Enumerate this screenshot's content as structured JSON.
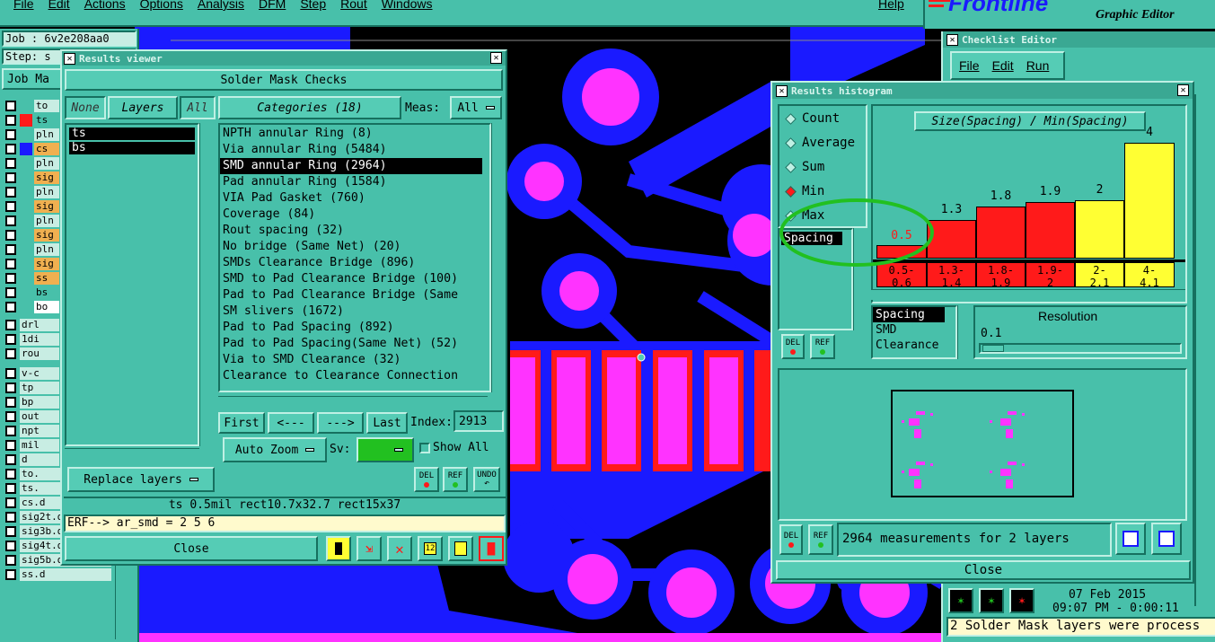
{
  "app": {
    "menu": [
      "File",
      "Edit",
      "Actions",
      "Options",
      "Analysis",
      "DFM",
      "Step",
      "Rout",
      "Windows"
    ],
    "help": "Help",
    "brand": "Frontline",
    "brand_sub": "Graphic Editor"
  },
  "job_label": "Job : 6v2e208aa0",
  "step_label": "Step: s",
  "job_matrix_btn": "Job Ma",
  "layers_panel": [
    "to",
    "ts",
    "pln",
    "cs",
    "pln",
    "sig",
    "pln",
    "sig",
    "pln",
    "sig",
    "pln",
    "sig",
    "ss",
    "bs",
    "bo",
    "drl",
    "1di",
    "rou",
    "v-c",
    "tp",
    "bp",
    "out",
    "npt",
    "mil",
    "d",
    "to.",
    "ts.",
    "cs.d",
    "sig2t.d",
    "sig3b.d",
    "sig4t.d",
    "sig5b.d",
    "ss.d"
  ],
  "results_viewer": {
    "title": "Results viewer",
    "header": "Solder Mask Checks",
    "none_btn": "None",
    "layers_btn": "Layers",
    "all_btn": "All",
    "layers": [
      "ts",
      "bs"
    ],
    "categories_btn": "Categories (18)",
    "meas_label": "Meas:",
    "meas_value": "All",
    "categories": [
      "NPTH annular Ring (8)",
      "Via annular Ring (5484)",
      "SMD annular Ring (2964)",
      "Pad annular Ring (1584)",
      "VIA Pad Gasket (760)",
      "Coverage (84)",
      "Rout spacing (32)",
      "No bridge (Same Net) (20)",
      "SMDs Clearance Bridge (896)",
      "SMD to Pad Clearance Bridge (100)",
      "Pad to Pad Clearance Bridge (Same",
      "SM slivers (1672)",
      "Pad to Pad Spacing (892)",
      "Pad to Pad Spacing(Same Net) (52)",
      "Via to SMD Clearance (32)",
      "Clearance to Clearance Connection"
    ],
    "first_btn": "First",
    "prev_btn": "<---",
    "next_btn": "--->",
    "last_btn": "Last",
    "index_label": "Index:",
    "index_value": "2913",
    "autozoom": "Auto Zoom",
    "sv_label": "Sv:",
    "show_all": "Show All",
    "replace_layers": "Replace layers",
    "del": "DEL",
    "ref": "REF",
    "undo": "UNDO",
    "status": "ts 0.5mil   rect10.7x32.7   rect15x37",
    "erf": "ERF--> ar_smd = 2 5 6",
    "close": "Close"
  },
  "checklist": {
    "title": "Checklist Editor",
    "menu": [
      "File",
      "Edit",
      "Run"
    ],
    "date": "07 Feb 2015",
    "time": "09:07 PM - 0:00:11",
    "status": "2 Solder Mask layers were process"
  },
  "histogram": {
    "title": "Results histogram",
    "modes": [
      "Count",
      "Average",
      "Sum",
      "Min",
      "Max"
    ],
    "selected_mode": "Min",
    "chart_title": "Size(Spacing) / Min(Spacing)",
    "bars": [
      {
        "value": "0.5",
        "range": [
          "0.5-",
          "0.6"
        ],
        "color": "#ff1a1a",
        "level": 0.09
      },
      {
        "value": "1.3",
        "range": [
          "1.3-",
          "1.4"
        ],
        "color": "#ff1a1a",
        "level": 0.25
      },
      {
        "value": "1.8",
        "range": [
          "1.8-",
          "1.9"
        ],
        "color": "#ff1a1a",
        "level": 0.34
      },
      {
        "value": "1.9",
        "range": [
          "1.9-",
          "2"
        ],
        "color": "#ff1a1a",
        "level": 0.37
      },
      {
        "value": "2",
        "range": [
          "2-",
          "2.1"
        ],
        "color": "#ffff33",
        "level": 0.38
      },
      {
        "value": "4",
        "range": [
          "4-",
          "4.1"
        ],
        "color": "#ffff33",
        "level": 0.76
      }
    ],
    "meas_list": [
      "Spacing"
    ],
    "types": [
      "Spacing",
      "SMD",
      "Clearance"
    ],
    "resolution_label": "Resolution",
    "resolution_value": "0.1",
    "summary": "2964 measurements for 2 layers",
    "del": "DEL",
    "ref": "REF",
    "close": "Close"
  },
  "colors": {
    "teal": "#48c0aa",
    "magenta": "#ff33ff",
    "blue": "#1a1aff",
    "red": "#ff1a1a",
    "yellow": "#ffff33",
    "highlight": "#22c020"
  }
}
